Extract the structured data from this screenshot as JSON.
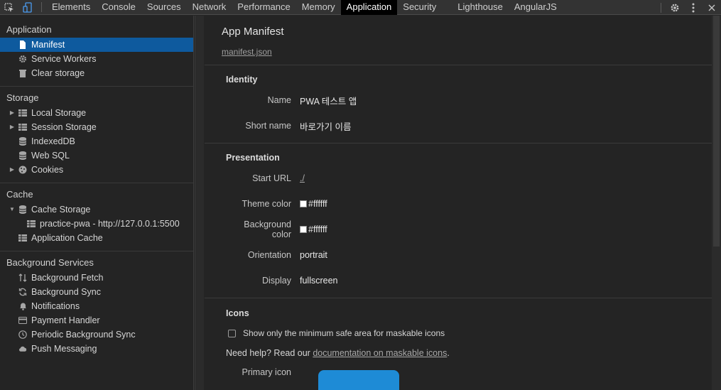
{
  "tabs": [
    "Elements",
    "Console",
    "Sources",
    "Network",
    "Performance",
    "Memory",
    "Application",
    "Security",
    "Lighthouse",
    "AngularJS"
  ],
  "active_tab": "Application",
  "sidebar": {
    "sections": [
      {
        "title": "Application",
        "items": [
          {
            "label": "Manifest",
            "icon": "document-icon",
            "selected": true
          },
          {
            "label": "Service Workers",
            "icon": "gear-icon"
          },
          {
            "label": "Clear storage",
            "icon": "trash-icon"
          }
        ]
      },
      {
        "title": "Storage",
        "items": [
          {
            "label": "Local Storage",
            "icon": "grid-icon",
            "expandable": true
          },
          {
            "label": "Session Storage",
            "icon": "grid-icon",
            "expandable": true
          },
          {
            "label": "IndexedDB",
            "icon": "database-icon"
          },
          {
            "label": "Web SQL",
            "icon": "database-icon"
          },
          {
            "label": "Cookies",
            "icon": "cookie-icon",
            "expandable": true
          }
        ]
      },
      {
        "title": "Cache",
        "items": [
          {
            "label": "Cache Storage",
            "icon": "database-icon",
            "expanded": true
          },
          {
            "label": "practice-pwa - http://127.0.0.1:5500",
            "icon": "grid-icon",
            "child": true
          },
          {
            "label": "Application Cache",
            "icon": "grid-icon"
          }
        ]
      },
      {
        "title": "Background Services",
        "items": [
          {
            "label": "Background Fetch",
            "icon": "updown-arrows-icon"
          },
          {
            "label": "Background Sync",
            "icon": "sync-icon"
          },
          {
            "label": "Notifications",
            "icon": "bell-icon"
          },
          {
            "label": "Payment Handler",
            "icon": "card-icon"
          },
          {
            "label": "Periodic Background Sync",
            "icon": "clock-icon"
          },
          {
            "label": "Push Messaging",
            "icon": "cloud-icon"
          }
        ]
      }
    ]
  },
  "main": {
    "title": "App Manifest",
    "manifest_link": "manifest.json",
    "identity": {
      "title": "Identity",
      "name_label": "Name",
      "name_value": "PWA 테스트 앱",
      "short_name_label": "Short name",
      "short_name_value": "바로가기 이름"
    },
    "presentation": {
      "title": "Presentation",
      "start_url_label": "Start URL",
      "start_url_value": "./",
      "theme_color_label": "Theme color",
      "theme_color_value": "#ffffff",
      "bg_color_label": "Background color",
      "bg_color_value": "#ffffff",
      "orientation_label": "Orientation",
      "orientation_value": "portrait",
      "display_label": "Display",
      "display_value": "fullscreen"
    },
    "icons": {
      "title": "Icons",
      "checkbox_label": "Show only the minimum safe area for maskable icons",
      "help_prefix": "Need help? Read our ",
      "help_link": "documentation on maskable icons",
      "help_suffix": ".",
      "primary_icon_label": "Primary icon"
    }
  },
  "colors": {
    "selection": "#0e5a9e",
    "icon_preview": "#1e8bd6"
  }
}
